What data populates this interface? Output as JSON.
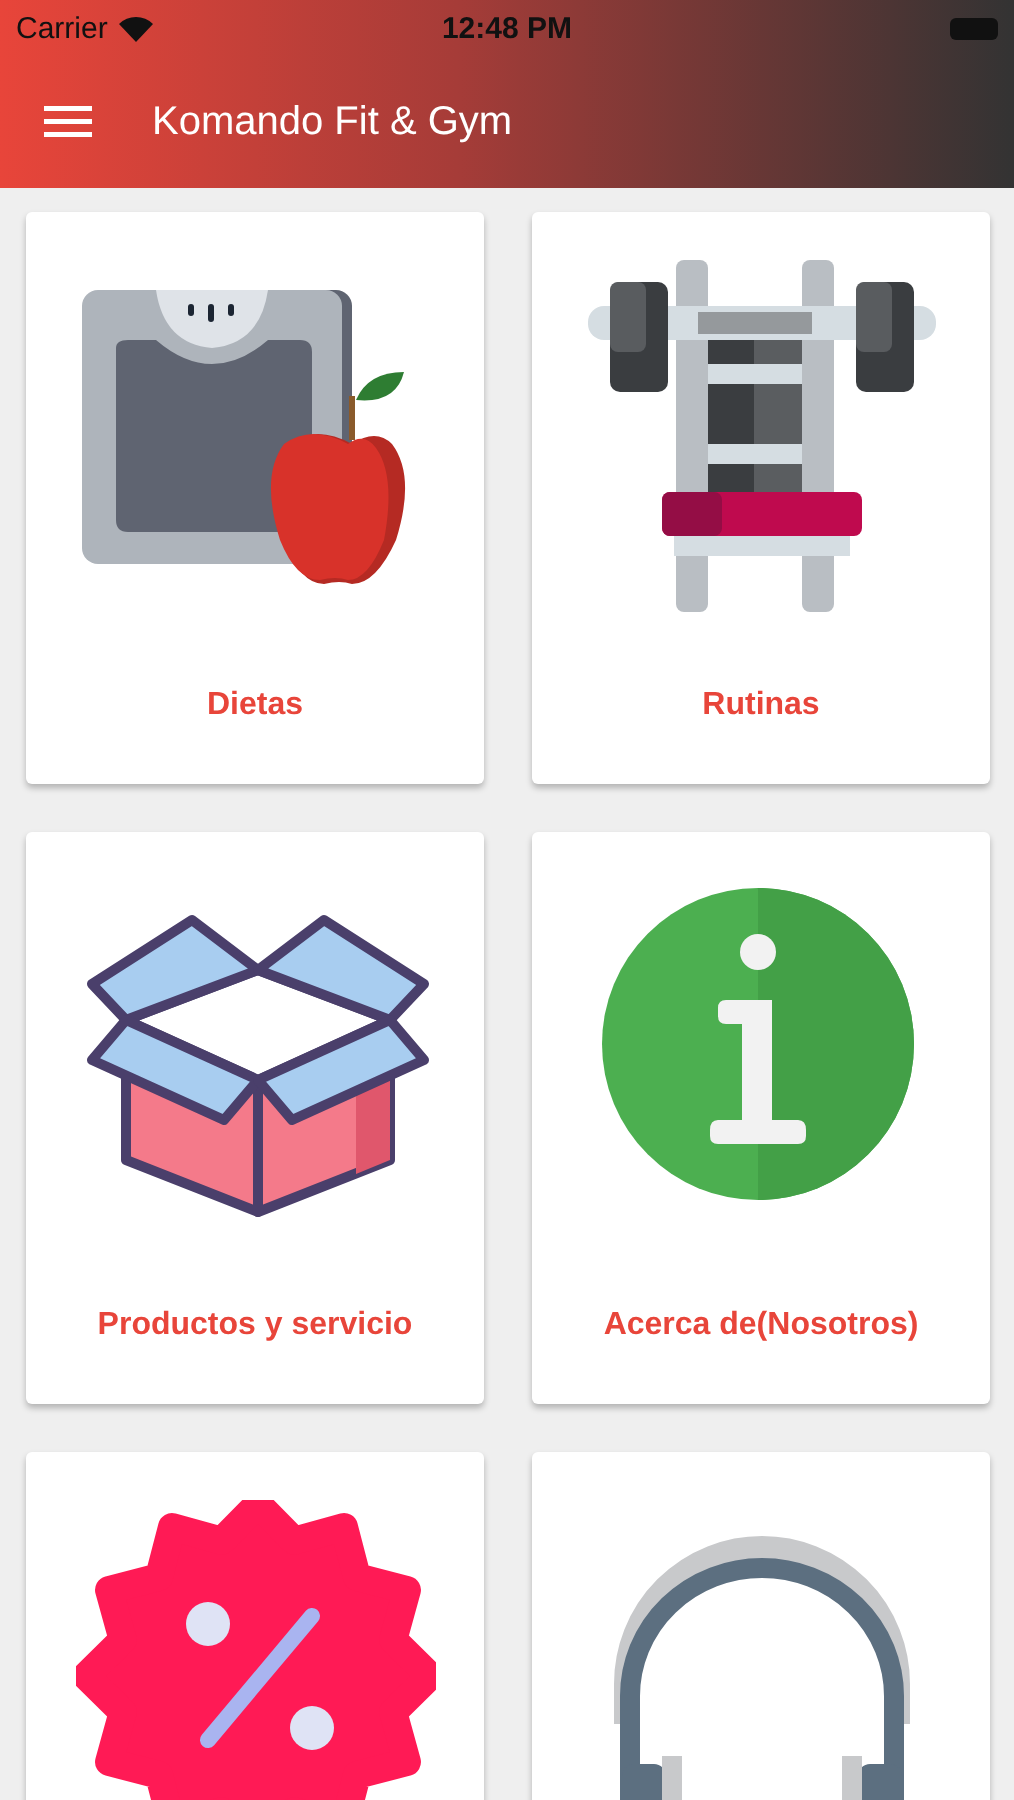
{
  "status_bar": {
    "carrier": "Carrier",
    "time": "12:48 PM"
  },
  "app_bar": {
    "title": "Komando Fit & Gym"
  },
  "tiles": [
    {
      "kind": "scale",
      "label": "Dietas"
    },
    {
      "kind": "bench",
      "label": "Rutinas"
    },
    {
      "kind": "box",
      "label": "Productos y servicio"
    },
    {
      "kind": "info",
      "label": "Acerca de(Nosotros)"
    },
    {
      "kind": "discount"
    },
    {
      "kind": "headphones"
    }
  ]
}
